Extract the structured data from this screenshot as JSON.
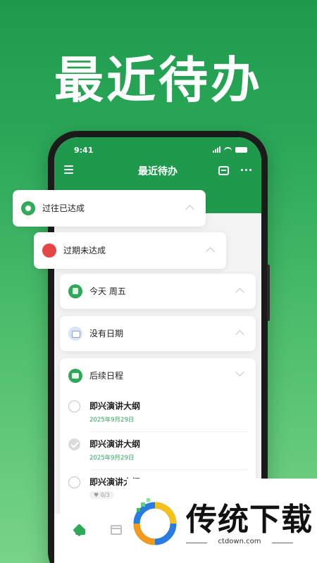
{
  "hero_title": "最近待办",
  "status": {
    "time": "9:41"
  },
  "app": {
    "title": "最近待办"
  },
  "groups": {
    "past_done": "过往已达成",
    "overdue": "过期未达成",
    "today": "今天 周五",
    "no_date": "没有日期",
    "upcoming": "后续日程"
  },
  "tasks": [
    {
      "title": "即兴演讲大纲",
      "date": "2025年9月29日",
      "done": false
    },
    {
      "title": "即兴演讲大纲",
      "date": "2025年9月29日",
      "done": true
    },
    {
      "title": "即兴演讲大纲",
      "subtasks": "0/3",
      "done": false
    }
  ],
  "watermark": {
    "name": "传统下载",
    "url": "ctdown.com"
  },
  "colors": {
    "brand_green": "#1f9a4c",
    "accent_green": "#2fa85a",
    "danger_red": "#e64646"
  }
}
